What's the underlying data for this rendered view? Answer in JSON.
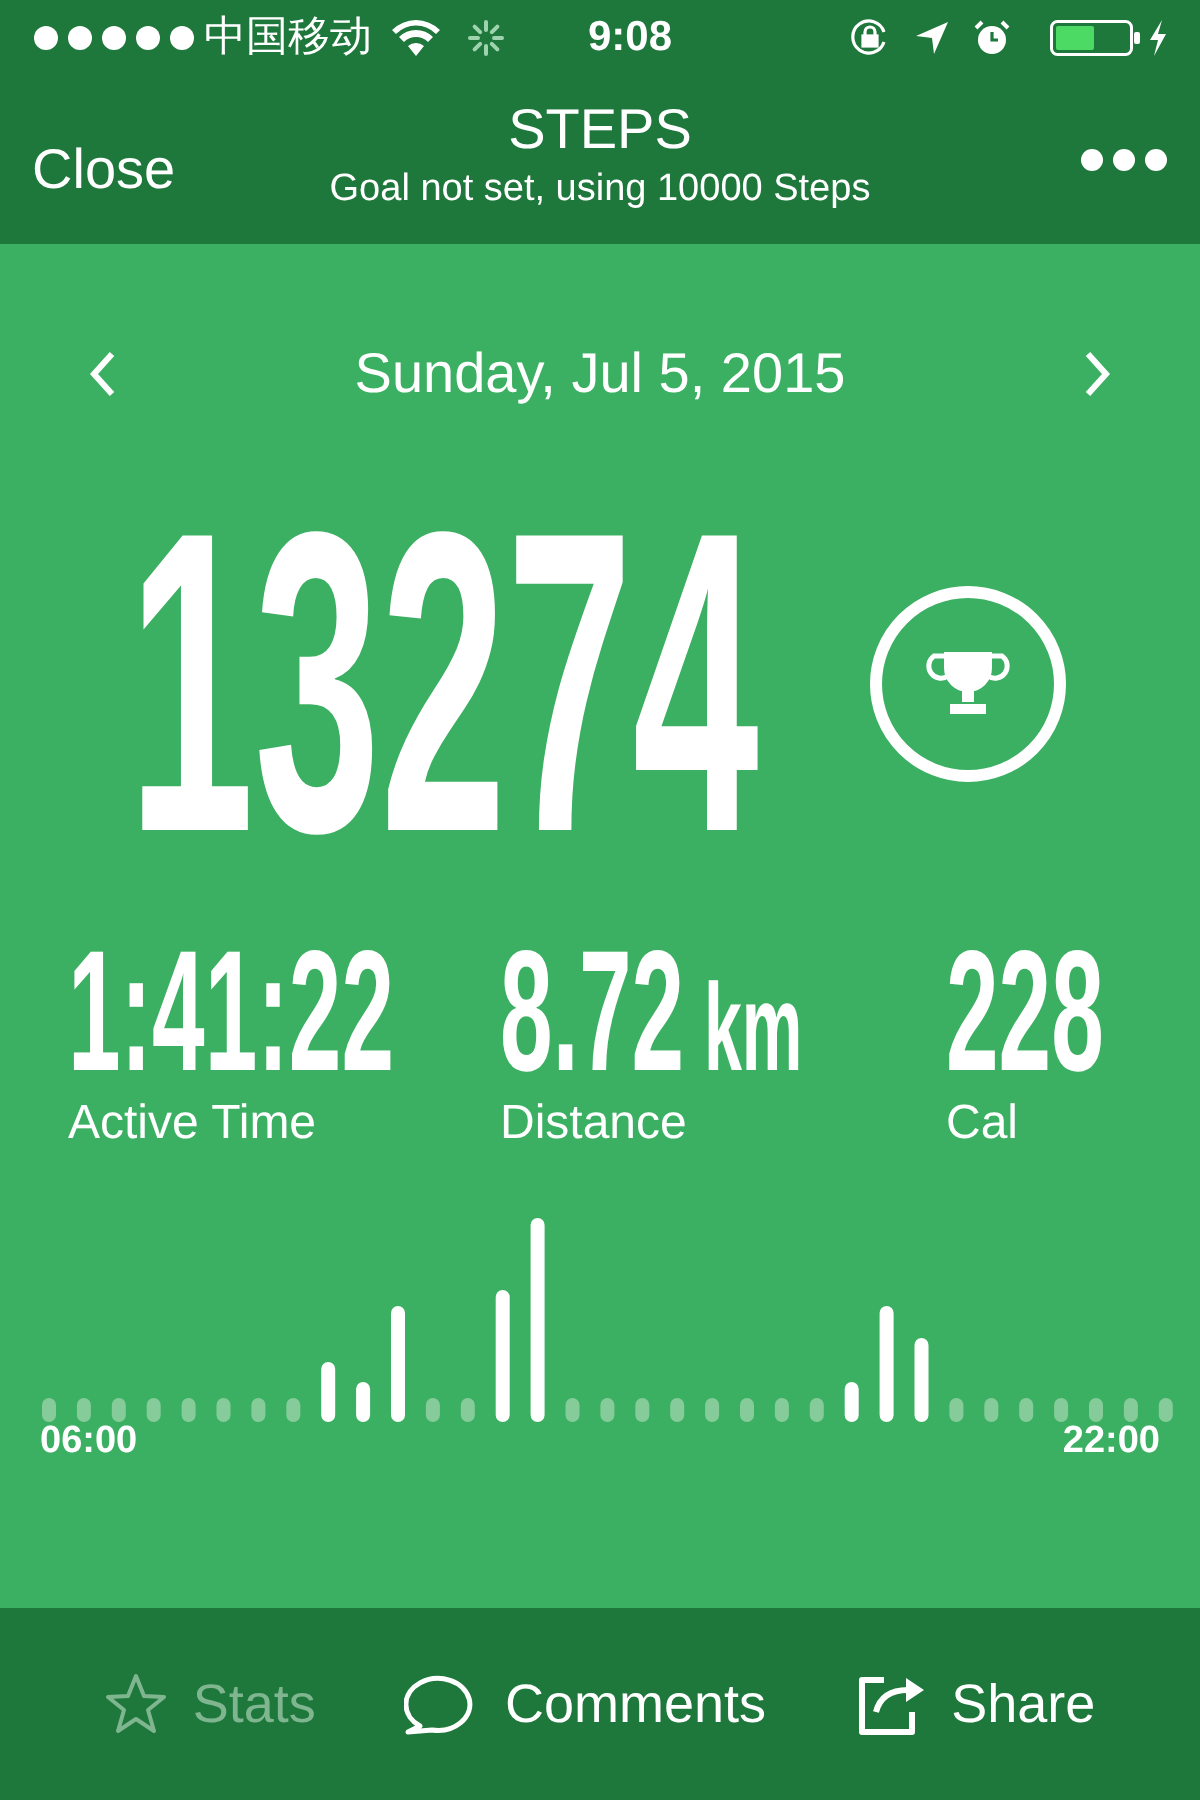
{
  "status_bar": {
    "carrier": "中国移动",
    "time": "9:08"
  },
  "nav": {
    "close": "Close",
    "title": "STEPS",
    "subtitle": "Goal not set, using 10000 Steps"
  },
  "date": "Sunday, Jul 5, 2015",
  "steps": "13274",
  "stats": [
    {
      "value": "1:41:22",
      "label": "Active Time"
    },
    {
      "value": "8.72",
      "unit": "km",
      "label": "Distance"
    },
    {
      "value": "228",
      "label": "Cal"
    }
  ],
  "chart": {
    "start": "06:00",
    "end": "22:00"
  },
  "toolbar": [
    {
      "kind": "star",
      "label": "Stats",
      "disabled": true
    },
    {
      "kind": "comment",
      "label": "Comments",
      "disabled": false
    },
    {
      "kind": "share",
      "label": "Share",
      "disabled": false
    }
  ]
}
